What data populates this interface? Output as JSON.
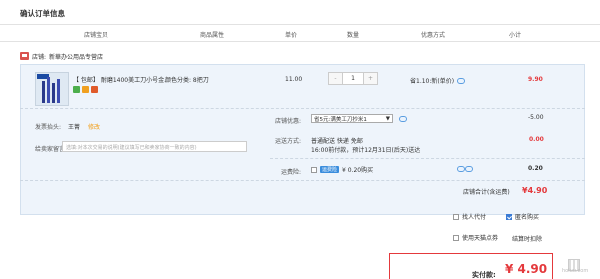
{
  "page_title": "确认订单信息",
  "columns": [
    "店铺宝贝",
    "商品属性",
    "单价",
    "数量",
    "优惠方式",
    "小计"
  ],
  "shop": {
    "label": "店铺:",
    "name": "新華办公用品专营店"
  },
  "item": {
    "name": "【 包邮】 耐磨1400美工刀小号金...",
    "attr": "颜色分类: 8把刀",
    "unit_price": "11.00",
    "quantity": "1",
    "minus": "-",
    "plus": "+",
    "discount": "省1.10:新(单价)",
    "subtotal": "9.90"
  },
  "invoice": {
    "label": "发票抬头:",
    "value": "王菁",
    "edit": "修改"
  },
  "store_discount": {
    "label": "店铺优惠:",
    "selected": "省5元:满美工刀抄米1",
    "amount": "-5.00"
  },
  "message": {
    "label": "给卖家留言:",
    "placeholder": "选填:对本次交易的说明(建议填写已和卖家协商一致的内容)"
  },
  "shipping": {
    "label": "运送方式:",
    "line1": "普通配送 快递 免邮",
    "line2": "16:00前付款，预计12月31日(后天)送达",
    "amount": "0.00"
  },
  "insurance": {
    "label": "运费险:",
    "badge": "运费险",
    "text": "¥ 0.20购买",
    "amount": "0.20"
  },
  "shop_total": {
    "label": "店铺合计(含运费)",
    "value": "¥4.90"
  },
  "options": {
    "pay_for_other": "找人代付",
    "anonymous": "匿名购买",
    "use_points": "使用天猫点券",
    "settle": "结算时扣除"
  },
  "pay": {
    "label": "实付款:",
    "value": "¥ 4.90"
  },
  "watermark": "hoiuu.com"
}
